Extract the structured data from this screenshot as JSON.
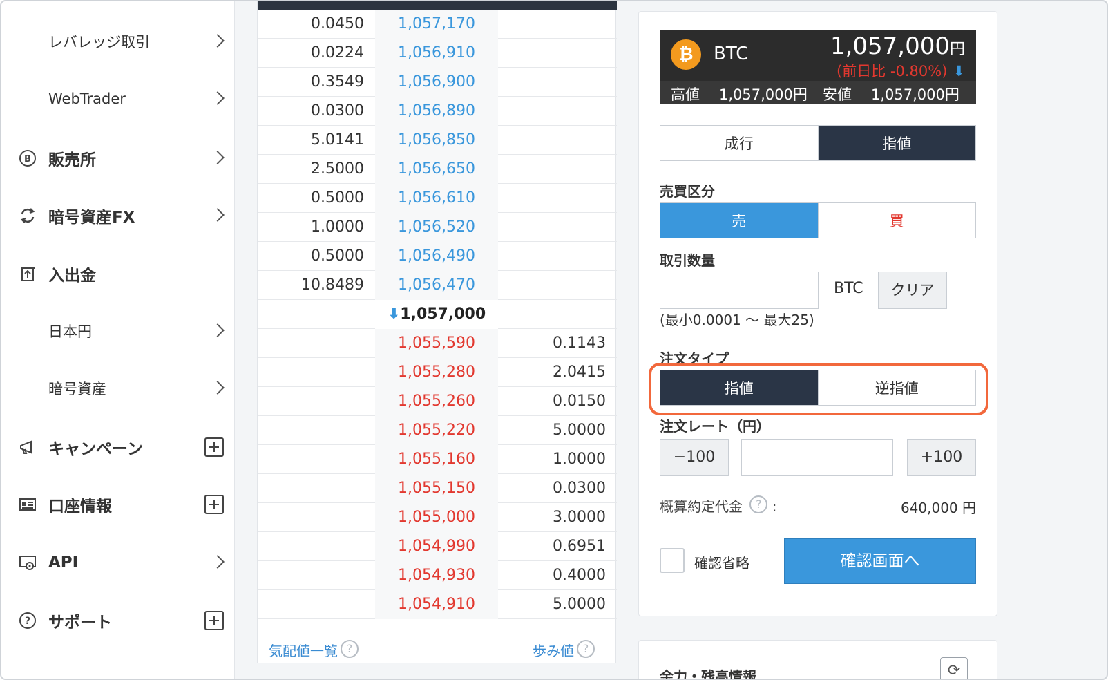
{
  "sidebar": {
    "items": [
      {
        "label": "レバレッジ取引",
        "type": "sub",
        "action": "chevron"
      },
      {
        "label": "WebTrader",
        "type": "sub",
        "action": "chevron"
      },
      {
        "label": "販売所",
        "type": "main",
        "icon": "bitcoin-circle-icon",
        "action": "chevron"
      },
      {
        "label": "暗号資産FX",
        "type": "main",
        "icon": "exchange-arrows-icon",
        "action": "chevron"
      },
      {
        "label": "入出金",
        "type": "main",
        "icon": "deposit-withdraw-icon",
        "action": "none"
      },
      {
        "label": "日本円",
        "type": "sub",
        "action": "chevron"
      },
      {
        "label": "暗号資産",
        "type": "sub",
        "action": "chevron"
      },
      {
        "label": "キャンペーン",
        "type": "main",
        "icon": "megaphone-icon",
        "action": "plus"
      },
      {
        "label": "口座情報",
        "type": "main",
        "icon": "id-card-icon",
        "action": "plus"
      },
      {
        "label": "API",
        "type": "main",
        "icon": "api-gear-icon",
        "action": "chevron"
      },
      {
        "label": "サポート",
        "type": "main",
        "icon": "help-circle-icon",
        "action": "plus"
      }
    ]
  },
  "order_book": {
    "asks": [
      {
        "size": "0.0450",
        "price": "1,057,170"
      },
      {
        "size": "0.0224",
        "price": "1,056,910"
      },
      {
        "size": "0.3549",
        "price": "1,056,900"
      },
      {
        "size": "0.0300",
        "price": "1,056,890"
      },
      {
        "size": "5.0141",
        "price": "1,056,850"
      },
      {
        "size": "2.5000",
        "price": "1,056,650"
      },
      {
        "size": "0.5000",
        "price": "1,056,610"
      },
      {
        "size": "1.0000",
        "price": "1,056,520"
      },
      {
        "size": "0.5000",
        "price": "1,056,490"
      },
      {
        "size": "10.8489",
        "price": "1,056,470"
      }
    ],
    "mid": {
      "arrow": "⬇",
      "price": "1,057,000"
    },
    "bids": [
      {
        "price": "1,055,590",
        "size": "0.1143"
      },
      {
        "price": "1,055,280",
        "size": "2.0415"
      },
      {
        "price": "1,055,260",
        "size": "0.0150"
      },
      {
        "price": "1,055,220",
        "size": "5.0000"
      },
      {
        "price": "1,055,160",
        "size": "1.0000"
      },
      {
        "price": "1,055,150",
        "size": "0.0300"
      },
      {
        "price": "1,055,000",
        "size": "3.0000"
      },
      {
        "price": "1,054,990",
        "size": "0.6951"
      },
      {
        "price": "1,054,930",
        "size": "0.4000"
      },
      {
        "price": "1,054,910",
        "size": "5.0000"
      }
    ],
    "footer": {
      "left_link": "気配値一覧",
      "right_link": "歩み値",
      "help": "?"
    }
  },
  "ticker": {
    "logo": "₿",
    "symbol": "BTC",
    "price": "1,057,000",
    "price_unit": "円",
    "change": "(前日比 -0.80%)",
    "change_arrow": "⬇",
    "high_label": "高値",
    "high_value": "1,057,000円",
    "low_label": "安値",
    "low_value": "1,057,000円"
  },
  "order_form": {
    "order_method": {
      "options": [
        "成行",
        "指値"
      ],
      "selected": "指値"
    },
    "side_label": "売買区分",
    "side": {
      "sell": "売",
      "buy": "買",
      "selected": "売"
    },
    "qty_label": "取引数量",
    "qty_value": "",
    "qty_unit": "BTC",
    "clear_label": "クリア",
    "qty_range": "(最小0.0001 〜 最大25)",
    "order_type_label": "注文タイプ",
    "order_type": {
      "options": [
        "指値",
        "逆指値"
      ],
      "selected": "指値"
    },
    "rate_label": "注文レート（円）",
    "minus_label": "−100",
    "plus_label": "+100",
    "rate_value": "",
    "estimate_label": "概算約定代金",
    "estimate_help": "?",
    "estimate_colon": ":",
    "estimate_value": "640,000 円",
    "skip_confirm_label": "確認省略",
    "confirm_label": "確認画面へ"
  },
  "balance_panel": {
    "title": "余力・残高情報",
    "refresh_icon": "⟳"
  },
  "colors": {
    "accent_blue": "#3a97dc",
    "ask_red": "#e2382f",
    "navy": "#2a3546",
    "highlight": "#f2683c",
    "btc_orange": "#f39a1e"
  }
}
